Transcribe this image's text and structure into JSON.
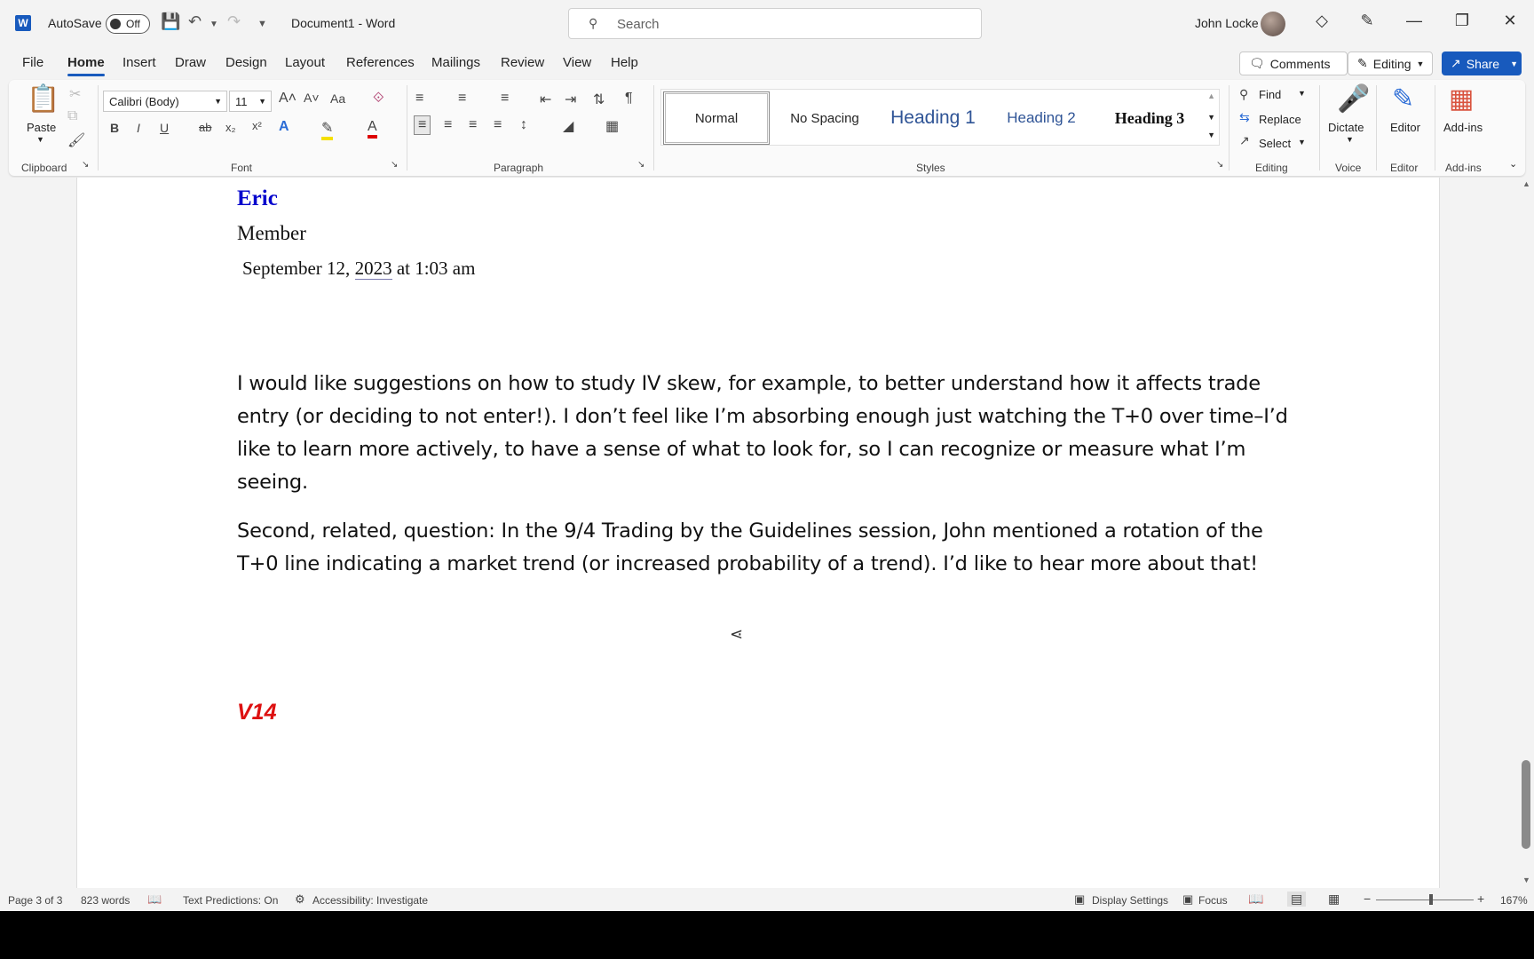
{
  "titlebar": {
    "app_logo": "W",
    "autosave_label": "AutoSave",
    "autosave_state": "Off",
    "doc_title": "Document1  -  Word",
    "search_placeholder": "Search",
    "user_name": "John Locke"
  },
  "tabs": [
    "File",
    "Home",
    "Insert",
    "Draw",
    "Design",
    "Layout",
    "References",
    "Mailings",
    "Review",
    "View",
    "Help"
  ],
  "active_tab": "Home",
  "actions": {
    "comments": "Comments",
    "editing": "Editing",
    "share": "Share"
  },
  "ribbon": {
    "clipboard": {
      "paste": "Paste",
      "label": "Clipboard"
    },
    "font": {
      "family": "Calibri (Body)",
      "size": "11",
      "label": "Font",
      "change_case": "Aa"
    },
    "paragraph": {
      "label": "Paragraph"
    },
    "styles": {
      "items": [
        "Normal",
        "No Spacing",
        "Heading 1",
        "Heading 2",
        "Heading 3"
      ],
      "label": "Styles"
    },
    "editing": {
      "find": "Find",
      "replace": "Replace",
      "select": "Select",
      "label": "Editing"
    },
    "voice": {
      "dictate": "Dictate",
      "label": "Voice"
    },
    "editor": {
      "editor": "Editor",
      "label": "Editor"
    },
    "addins": {
      "addins": "Add-ins",
      "label": "Add-ins"
    }
  },
  "document": {
    "author": "Eric",
    "role": "Member",
    "date_pre": "September 12, ",
    "date_year": "2023",
    "date_post": " at 1:03 am",
    "para1": "I would like suggestions on how to study IV skew, for example, to better understand how it affects trade entry (or deciding to not enter!). I don’t feel like I’m absorbing enough just watching the T+0 over time–I’d like to learn more actively, to have a sense of what to look for, so I can recognize or measure what I’m seeing.",
    "para2": "Second, related, question: In the 9/4 Trading by the Guidelines session, John mentioned a rotation of the T+0 line indicating a market trend (or increased probability of a trend). I’d like to hear more about that!",
    "heading": "V14"
  },
  "statusbar": {
    "page": "Page 3 of 3",
    "words": "823 words",
    "text_predictions": "Text Predictions: On",
    "accessibility": "Accessibility: Investigate",
    "display_settings": "Display Settings",
    "focus": "Focus",
    "zoom_minus": "−",
    "zoom_plus": "+",
    "zoom": "167%"
  },
  "colors": {
    "accent": "#185abd",
    "author": "#0000cc",
    "heading_red": "#dd1111"
  }
}
